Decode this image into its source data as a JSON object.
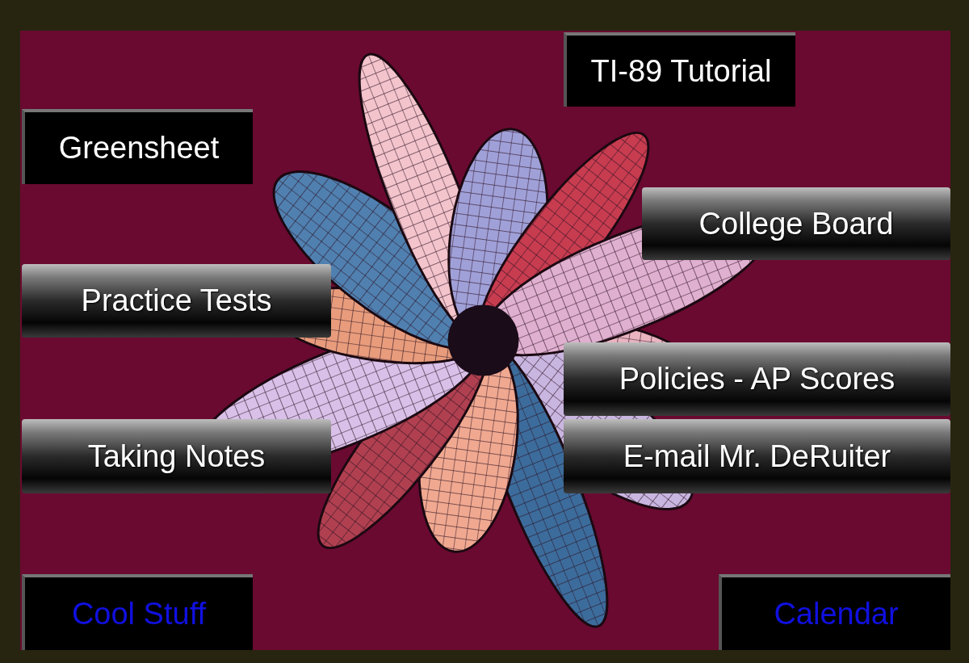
{
  "buttons": [
    {
      "label": "TI-89 Tutorial",
      "kind": "plain"
    },
    {
      "label": "Greensheet",
      "kind": "plain"
    },
    {
      "label": "College Board",
      "kind": "glossy"
    },
    {
      "label": "Practice Tests",
      "kind": "glossy"
    },
    {
      "label": "Policies - AP Scores",
      "kind": "glossy"
    },
    {
      "label": "Taking Notes",
      "kind": "glossy"
    },
    {
      "label": "E-mail Mr. DeRuiter",
      "kind": "glossy"
    },
    {
      "label": "Cool Stuff",
      "kind": "link"
    },
    {
      "label": "Calendar",
      "kind": "link"
    }
  ]
}
